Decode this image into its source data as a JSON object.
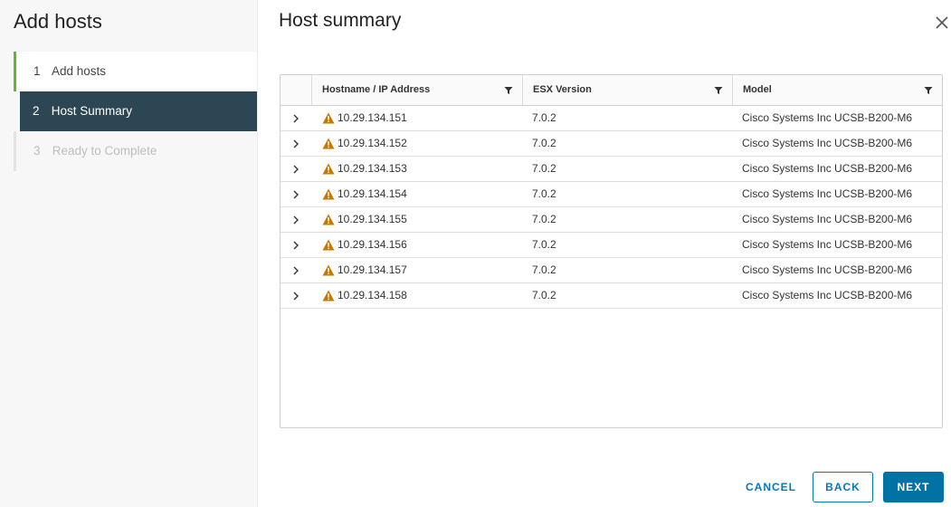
{
  "sidebar": {
    "title": "Add hosts",
    "steps": [
      {
        "num": "1",
        "label": "Add hosts"
      },
      {
        "num": "2",
        "label": "Host Summary"
      },
      {
        "num": "3",
        "label": "Ready to Complete"
      }
    ]
  },
  "main": {
    "title": "Host summary"
  },
  "grid": {
    "columns": [
      "Hostname / IP Address",
      "ESX Version",
      "Model"
    ],
    "rows": [
      {
        "host": "10.29.134.151",
        "esx": "7.0.2",
        "model": "Cisco Systems Inc UCSB-B200-M6"
      },
      {
        "host": "10.29.134.152",
        "esx": "7.0.2",
        "model": "Cisco Systems Inc UCSB-B200-M6"
      },
      {
        "host": "10.29.134.153",
        "esx": "7.0.2",
        "model": "Cisco Systems Inc UCSB-B200-M6"
      },
      {
        "host": "10.29.134.154",
        "esx": "7.0.2",
        "model": "Cisco Systems Inc UCSB-B200-M6"
      },
      {
        "host": "10.29.134.155",
        "esx": "7.0.2",
        "model": "Cisco Systems Inc UCSB-B200-M6"
      },
      {
        "host": "10.29.134.156",
        "esx": "7.0.2",
        "model": "Cisco Systems Inc UCSB-B200-M6"
      },
      {
        "host": "10.29.134.157",
        "esx": "7.0.2",
        "model": "Cisco Systems Inc UCSB-B200-M6"
      },
      {
        "host": "10.29.134.158",
        "esx": "7.0.2",
        "model": "Cisco Systems Inc UCSB-B200-M6"
      }
    ]
  },
  "footer": {
    "cancel": "CANCEL",
    "back": "BACK",
    "next": "NEXT"
  },
  "colors": {
    "accent": "#0072a3",
    "active_step": "#2c4653",
    "done_step": "#5fb832",
    "warning": "#c27b00"
  },
  "icons": {
    "close": "close-icon",
    "filter": "filter-icon",
    "expand": "chevron-right-icon",
    "status": "warning-icon"
  }
}
